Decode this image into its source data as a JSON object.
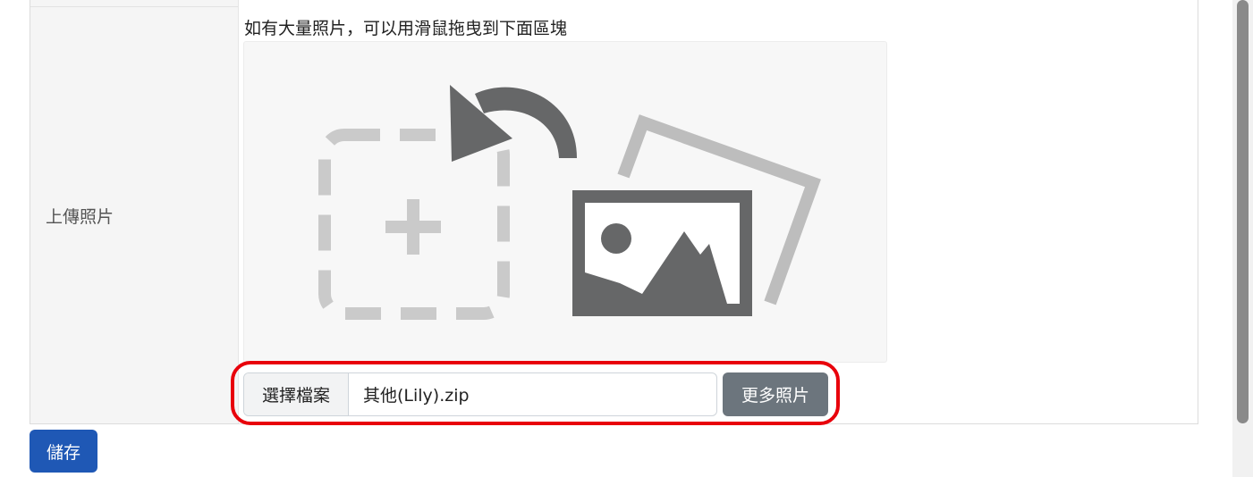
{
  "form": {
    "row_label": "上傳照片",
    "drop_hint": "如有大量照片，可以用滑鼠拖曳到下面區塊",
    "file_input": {
      "button_label": "選擇檔案",
      "file_name": "其他(Lily).zip"
    },
    "more_photos_label": "更多照片",
    "save_label": "儲存"
  },
  "icons": {
    "dropzone": [
      "dashed-add-frame-icon",
      "arrow-curve-icon",
      "photo-stack-icon"
    ]
  },
  "colors": {
    "save_button": "#1f58b5",
    "more_button": "#6c757d",
    "highlight_outline": "#e8000b"
  }
}
